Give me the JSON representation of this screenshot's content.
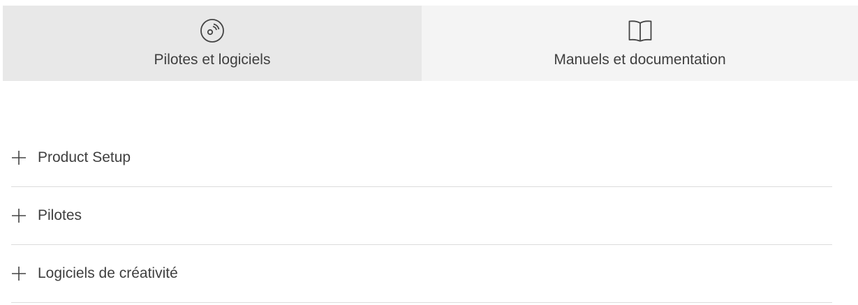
{
  "tabs": [
    {
      "label": "Pilotes et logiciels",
      "icon": "disc-icon",
      "active": true
    },
    {
      "label": "Manuels et documentation",
      "icon": "open-book-icon",
      "active": false
    }
  ],
  "accordion": {
    "items": [
      {
        "label": "Product Setup",
        "icon": "plus-icon"
      },
      {
        "label": "Pilotes",
        "icon": "plus-icon"
      },
      {
        "label": "Logiciels de créativité",
        "icon": "plus-icon"
      }
    ]
  },
  "colors": {
    "active_tab_bg": "#e8e8e8",
    "inactive_tab_bg": "#f4f4f4",
    "text": "#3f3f3f",
    "divider": "#dcdcdc"
  }
}
